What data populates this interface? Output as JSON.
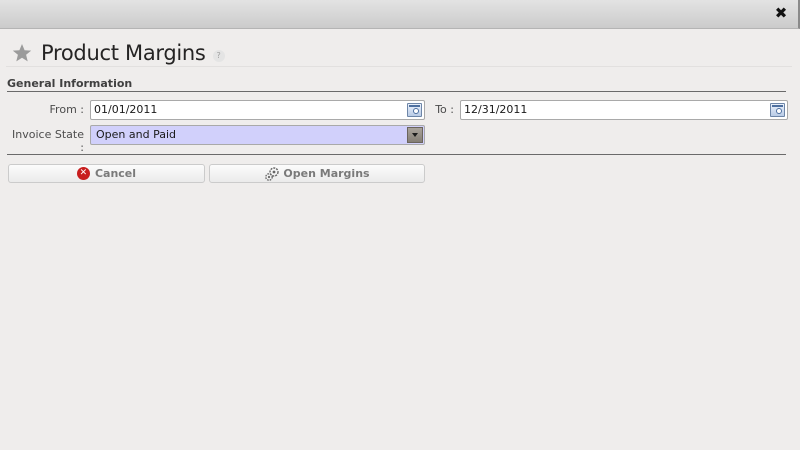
{
  "window": {
    "close_glyph": "✖"
  },
  "header": {
    "star_icon": "star-icon",
    "title": "Product Margins",
    "help_glyph": "?"
  },
  "section": {
    "title": "General Information"
  },
  "form": {
    "from_label": "From :",
    "from_value": "01/01/2011",
    "to_label": "To :",
    "to_value": "12/31/2011",
    "invoice_state_label": "Invoice State :",
    "invoice_state_value": "Open and Paid"
  },
  "actions": {
    "cancel_label": "Cancel",
    "open_margins_label": "Open Margins"
  },
  "colors": {
    "background": "#efedec",
    "select_highlight": "#d1d0fb",
    "cancel_red": "#c81e1e"
  }
}
